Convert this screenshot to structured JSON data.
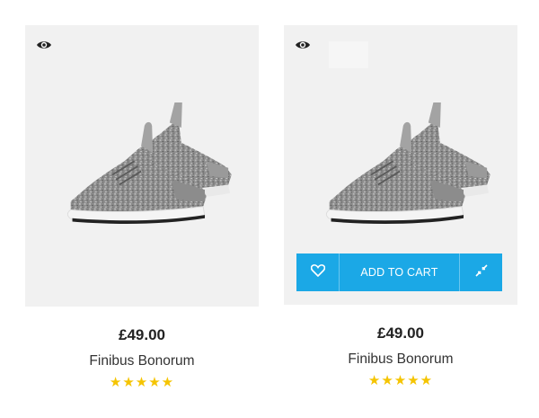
{
  "colors": {
    "accent": "#1ba8e6",
    "star": "#f5c400",
    "card_bg": "#f1f1f1"
  },
  "products": [
    {
      "price": "£49.00",
      "name": "Finibus Bonorum",
      "rating": 5,
      "image": "gray-knit-sneakers",
      "icons": [
        "eye-icon"
      ],
      "show_actions": false
    },
    {
      "price": "£49.00",
      "name": "Finibus Bonorum",
      "rating": 5,
      "image": "gray-knit-sneakers",
      "icons": [
        "eye-icon",
        "heart-icon",
        "compare-icon"
      ],
      "show_actions": true,
      "add_to_cart_label": "ADD TO CART"
    }
  ]
}
